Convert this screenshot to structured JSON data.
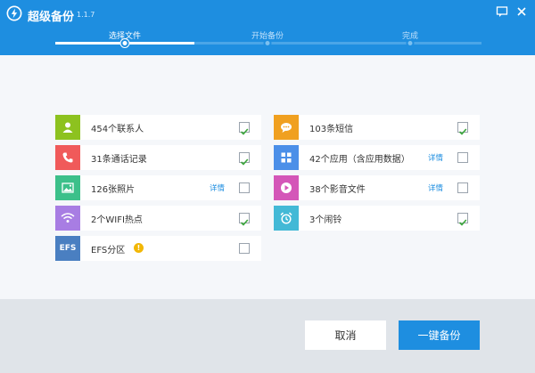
{
  "app": {
    "title": "超级备份",
    "version": "1.1.7"
  },
  "steps": [
    {
      "label": "选择文件"
    },
    {
      "label": "开始备份"
    },
    {
      "label": "完成"
    }
  ],
  "items": [
    {
      "label": "454个联系人",
      "icon": "contacts-icon",
      "color": "#8dc21f",
      "checked": true
    },
    {
      "label": "31条通话记录",
      "icon": "phone-icon",
      "color": "#f05a5a",
      "checked": true
    },
    {
      "label": "126张照片",
      "icon": "photo-icon",
      "color": "#3cc08a",
      "detail": "详情",
      "checked": false
    },
    {
      "label": "2个WIFI热点",
      "icon": "wifi-icon",
      "color": "#a87de3",
      "checked": true
    },
    {
      "label": "EFS分区",
      "icon": "efs-icon",
      "icon_text": "EFS",
      "color": "#4a7fc1",
      "checked": false,
      "warning_glyph": "!"
    },
    {
      "label": "103条短信",
      "icon": "sms-icon",
      "color": "#f0a020",
      "checked": true
    },
    {
      "label": "42个应用（含应用数据）",
      "icon": "apps-icon",
      "color": "#4b8fe8",
      "detail": "详情",
      "checked": false
    },
    {
      "label": "38个影音文件",
      "icon": "media-icon",
      "color": "#d456b8",
      "detail": "详情",
      "checked": false
    },
    {
      "label": "3个闹铃",
      "icon": "alarm-icon",
      "color": "#43b9d6",
      "checked": true
    }
  ],
  "buttons": {
    "cancel": "取消",
    "backup": "一键备份"
  }
}
